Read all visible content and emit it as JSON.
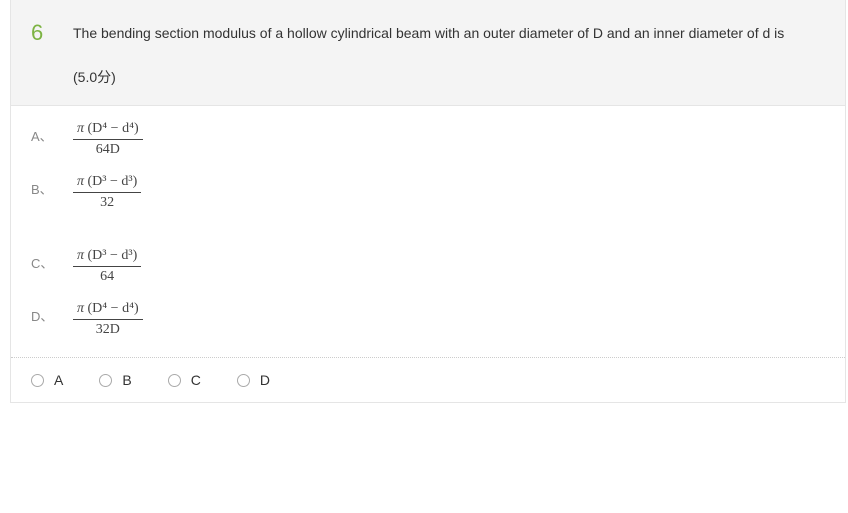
{
  "question": {
    "number": "6",
    "text": "The bending section modulus of a hollow cylindrical beam with an outer diameter of D and an inner diameter of d is",
    "points": "(5.0分)"
  },
  "choices": {
    "A": {
      "label": "A、",
      "num_pi": "π",
      "num_expr": "(D⁴ − d⁴)",
      "den": "64D"
    },
    "B": {
      "label": "B、",
      "num_pi": "π",
      "num_expr": "(D³ − d³)",
      "den": "32"
    },
    "C": {
      "label": "C、",
      "num_pi": "π",
      "num_expr": "(D³ − d³)",
      "den": "64"
    },
    "D": {
      "label": "D、",
      "num_pi": "π",
      "num_expr": "(D⁴ − d⁴)",
      "den": "32D"
    }
  },
  "answers": {
    "A": "A",
    "B": "B",
    "C": "C",
    "D": "D"
  },
  "chart_data": {
    "type": "table",
    "title": "Multiple choice — bending section modulus of hollow cylindrical beam",
    "options": [
      {
        "key": "A",
        "formula": "π (D^4 − d^4) / (64 D)"
      },
      {
        "key": "B",
        "formula": "π (D^3 − d^3) / 32"
      },
      {
        "key": "C",
        "formula": "π (D^3 − d^3) / 64"
      },
      {
        "key": "D",
        "formula": "π (D^4 − d^4) / (32 D)"
      }
    ],
    "points": 5.0
  }
}
